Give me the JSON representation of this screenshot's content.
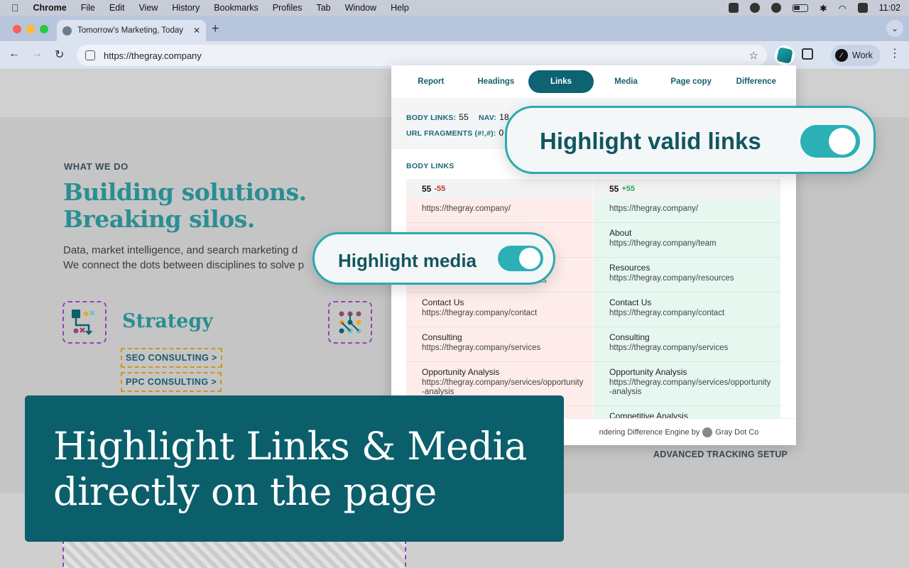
{
  "menubar": {
    "apple": "",
    "items": [
      "Chrome",
      "File",
      "Edit",
      "View",
      "History",
      "Bookmarks",
      "Profiles",
      "Tab",
      "Window",
      "Help"
    ],
    "time": "11:02"
  },
  "browser": {
    "tab_title": "Tomorrow's Marketing, Today",
    "url": "https://thegray.company",
    "profile": "Work"
  },
  "site": {
    "eyebrow": "WHAT WE DO",
    "headline_1": "Building solutions.",
    "headline_2": "Breaking silos.",
    "desc_1": "Data, market intelligence, and search marketing d",
    "desc_2": "We connect the dots between disciplines to solve p",
    "strategy": "Strategy",
    "link_1": "SEO CONSULTING >",
    "link_2": "PPC CONSULTING >",
    "adv": "ADVANCED TRACKING SETUP"
  },
  "popup": {
    "tabs": [
      "Report",
      "Headings",
      "Links",
      "Media",
      "Page copy",
      "Difference"
    ],
    "active_tab": "Links",
    "stats": {
      "body_links_label": "BODY LINKS:",
      "body_links": "55",
      "nav_label": "NAV:",
      "nav": "18",
      "frag_label": "URL FRAGMENTS (#!,#):",
      "frag": "0"
    },
    "section_title": "BODY LINKS",
    "left_col": {
      "count": "55",
      "delta": "-55",
      "rows": [
        {
          "label": "",
          "url": "https://thegray.company/"
        },
        {
          "label": "",
          "url": ""
        },
        {
          "label": "",
          "url": "https://thegray.company/resources"
        },
        {
          "label": "Contact Us",
          "url": "https://thegray.company/contact"
        },
        {
          "label": "Consulting",
          "url": "https://thegray.company/services"
        },
        {
          "label": "Opportunity Analysis",
          "url": "https://thegray.company/services/opportunity-analysis"
        }
      ]
    },
    "right_col": {
      "count": "55",
      "delta": "+55",
      "rows": [
        {
          "label": "",
          "url": "https://thegray.company/"
        },
        {
          "label": "About",
          "url": "https://thegray.company/team"
        },
        {
          "label": "Resources",
          "url": "https://thegray.company/resources"
        },
        {
          "label": "Contact Us",
          "url": "https://thegray.company/contact"
        },
        {
          "label": "Consulting",
          "url": "https://thegray.company/services"
        },
        {
          "label": "Opportunity Analysis",
          "url": "https://thegray.company/services/opportunity-analysis"
        },
        {
          "label": "Competitive Analysis",
          "url": ""
        }
      ]
    },
    "footer_text": "ndering Difference Engine by",
    "footer_brand": "Gray Dot Co"
  },
  "callouts": {
    "valid_links": "Highlight valid links",
    "media": "Highlight media"
  },
  "banner": {
    "line_1": "Highlight Links & Media",
    "line_2": "directly on the page"
  },
  "colors": {
    "teal_dark": "#0b5f6b",
    "teal": "#2aaab0",
    "accent_text": "#2a8e92"
  }
}
